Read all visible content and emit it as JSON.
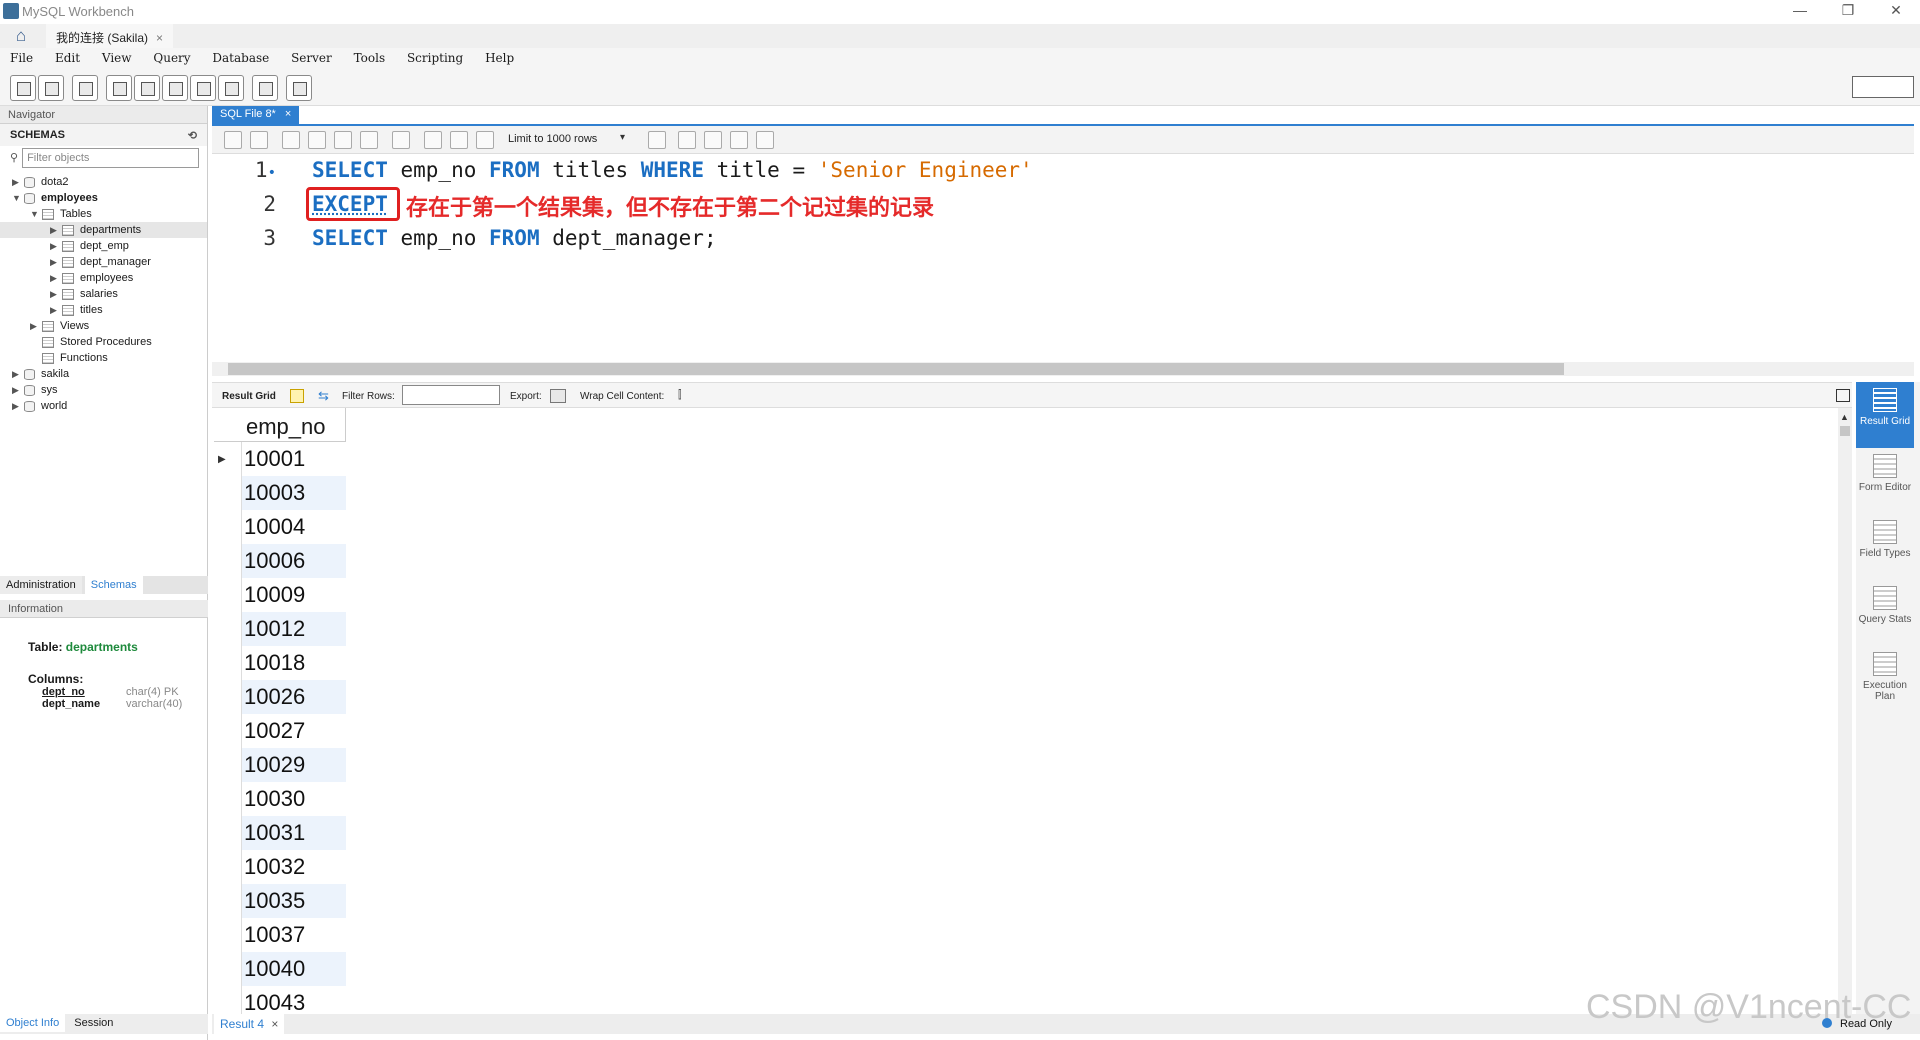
{
  "window": {
    "title": "MySQL Workbench",
    "connection_tab": "我的连接 (Sakila)",
    "close_glyph": "×"
  },
  "menu": [
    "File",
    "Edit",
    "View",
    "Query",
    "Database",
    "Server",
    "Tools",
    "Scripting",
    "Help"
  ],
  "navigator": {
    "header": "Navigator",
    "schemas_label": "SCHEMAS",
    "filter_placeholder": "Filter objects",
    "tree": {
      "dota2": "dota2",
      "employees": "employees",
      "tables": "Tables",
      "tables_list": [
        "departments",
        "dept_emp",
        "dept_manager",
        "employees",
        "salaries",
        "titles"
      ],
      "views": "Views",
      "stored_procedures": "Stored Procedures",
      "functions": "Functions",
      "sakila": "sakila",
      "sys": "sys",
      "world": "world"
    },
    "tab_administration": "Administration",
    "tab_schemas": "Schemas",
    "information_header": "Information",
    "info": {
      "table_label": "Table:",
      "table_name": "departments",
      "columns_label": "Columns:",
      "col1_name": "dept_no",
      "col1_type": "char(4) PK",
      "col2_name": "dept_name",
      "col2_type": "varchar(40)"
    },
    "bottom_tab_object": "Object Info",
    "bottom_tab_session": "Session"
  },
  "editor": {
    "tab_label": "SQL File 8*",
    "limit_label": "Limit to 1000 rows",
    "lines": [
      {
        "num": "1",
        "marker": "•"
      },
      {
        "num": "2",
        "marker": ""
      },
      {
        "num": "3",
        "marker": ""
      }
    ],
    "line1": {
      "kw1": "SELECT",
      "t1": " emp_no ",
      "kw2": "FROM",
      "t2": " titles ",
      "kw3": "WHERE",
      "t3": " title = ",
      "str": "'Senior Engineer'"
    },
    "line2": {
      "kw": "EXCEPT"
    },
    "line3": {
      "kw1": "SELECT",
      "t1": " emp_no ",
      "kw2": "FROM",
      "t2": " dept_manager;"
    },
    "annotation": "存在于第一个结果集，但不存在于第二个记过集的记录"
  },
  "result_toolbar": {
    "result_grid": "Result Grid",
    "filter_rows": "Filter Rows:",
    "export": "Export:",
    "wrap": "Wrap Cell Content:"
  },
  "grid": {
    "column": "emp_no",
    "rows": [
      "10001",
      "10003",
      "10004",
      "10006",
      "10009",
      "10012",
      "10018",
      "10026",
      "10027",
      "10029",
      "10030",
      "10031",
      "10032",
      "10035",
      "10037",
      "10040",
      "10043"
    ]
  },
  "right_panel": [
    {
      "label": "Result Grid",
      "icon": "result-grid-icon"
    },
    {
      "label": "Form Editor",
      "icon": "form-editor-icon"
    },
    {
      "label": "Field Types",
      "icon": "field-types-icon"
    },
    {
      "label": "Query Stats",
      "icon": "query-stats-icon"
    },
    {
      "label": "Execution Plan",
      "icon": "execution-plan-icon"
    }
  ],
  "status": {
    "result_tab": "Result 4",
    "read_only": "Read Only"
  },
  "watermark": "CSDN @V1ncent-CC",
  "colors": {
    "accent": "#2f7fd0",
    "annotation": "#e52a2a",
    "keyword": "#1b6ec2",
    "string": "#d66a00"
  }
}
